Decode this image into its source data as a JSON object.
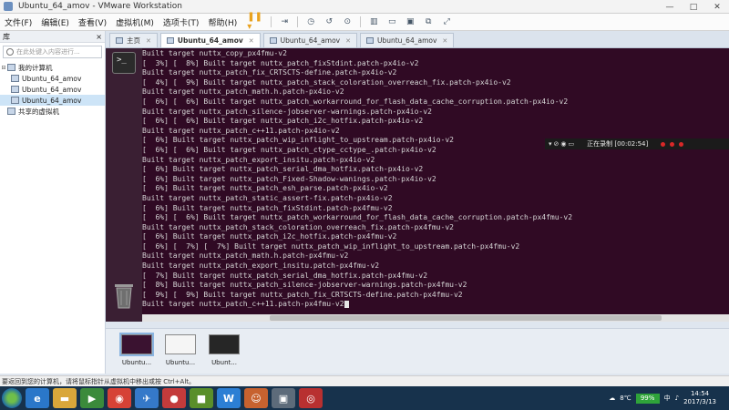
{
  "window": {
    "title": "Ubuntu_64_amov - VMware Workstation",
    "minimize": "—",
    "maximize": "□",
    "close": "✕"
  },
  "menu": {
    "items": [
      "文件(F)",
      "编辑(E)",
      "查看(V)",
      "虚拟机(M)",
      "选项卡(T)",
      "帮助(H)"
    ]
  },
  "library": {
    "header": "库",
    "close": "×",
    "search_placeholder": "在此处键入内容进行...",
    "tree": [
      {
        "label": "我的计算机",
        "level": 0,
        "selected": false
      },
      {
        "label": "Ubuntu_64_amov",
        "level": 1,
        "selected": false
      },
      {
        "label": "Ubuntu_64_amov",
        "level": 1,
        "selected": false
      },
      {
        "label": "Ubuntu_64_amov",
        "level": 1,
        "selected": true
      },
      {
        "label": "共享的虚拟机",
        "level": 0,
        "selected": false
      }
    ]
  },
  "tabs": [
    {
      "label": "主页",
      "active": false
    },
    {
      "label": "Ubuntu_64_amov",
      "active": true
    },
    {
      "label": "Ubuntu_64_amov",
      "active": false
    },
    {
      "label": "Ubuntu_64_amov",
      "active": false
    }
  ],
  "terminal": {
    "lines": [
      "Built target nuttx_copy_px4fmu-v2",
      "[  3%] [  8%] Built target nuttx_patch_fixStdint.patch-px4io-v2",
      "Built target nuttx_patch_fix_CRTSCTS-define.patch-px4io-v2",
      "[  4%] [  9%] Built target nuttx_patch_stack_coloration_overreach_fix.patch-px4io-v2",
      "Built target nuttx_patch_math.h.patch-px4io-v2",
      "[  6%] [  6%] Built target nuttx_patch_workarround_for_flash_data_cache_corruption.patch-px4io-v2",
      "Built target nuttx_patch_silence-jobserver-warnings.patch-px4io-v2",
      "[  6%] [  6%] Built target nuttx_patch_i2c_hotfix.patch-px4io-v2",
      "Built target nuttx_patch_c++11.patch-px4io-v2",
      "[  6%] Built target nuttx_patch_wip_inflight_to_upstream.patch-px4io-v2",
      "[  6%] [  6%] Built target nuttx_patch_ctype_cctype_.patch-px4io-v2",
      "Built target nuttx_patch_export_insitu.patch-px4io-v2",
      "[  6%] Built target nuttx_patch_serial_dma_hotfix.patch-px4io-v2",
      "[  6%] Built target nuttx_patch_Fixed-Shadow-wanings.patch-px4io-v2",
      "[  6%] Built target nuttx_patch_esh_parse.patch-px4io-v2",
      "Built target nuttx_patch_static_assert-fix.patch-px4io-v2",
      "[  6%] Built target nuttx_patch_fixStdint.patch-px4fmu-v2",
      "[  6%] [  6%] Built target nuttx_patch_workarround_for_flash_data_cache_corruption.patch-px4fmu-v2",
      "Built target nuttx_patch_stack_coloration_overreach_fix.patch-px4fmu-v2",
      "[  6%] Built target nuttx_patch_i2c_hotfix.patch-px4fmu-v2",
      "[  6%] [  7%] [  7%] Built target nuttx_patch_wip_inflight_to_upstream.patch-px4fmu-v2",
      "Built target nuttx_patch_math.h.patch-px4fmu-v2",
      "Built target nuttx_patch_export_insitu.patch-px4fmu-v2",
      "[  7%] Built target nuttx_patch_serial_dma_hotfix.patch-px4fmu-v2",
      "[  8%] Built target nuttx_patch_silence-jobserver-warnings.patch-px4fmu-v2",
      "[  9%] [  9%] Built target nuttx_patch_fix_CRTSCTS-define.patch-px4fmu-v2",
      "Built target nuttx_patch_c++11.patch-px4fmu-v2"
    ]
  },
  "recording": {
    "status": "正在录制 [00:02:54]"
  },
  "thumbnails": [
    {
      "label": "Ubuntu...",
      "selected": true
    },
    {
      "label": "Ubuntu...",
      "selected": false
    },
    {
      "label": "Ubunt...",
      "selected": false
    }
  ],
  "statusbar": {
    "text": "要返回到您的计算机，请将鼠标指针从虚拟机中移出或按 Ctrl+Alt。"
  },
  "taskbar": {
    "apps": [
      {
        "name": "ie-icon",
        "glyph": "e",
        "color": "#2a77c9"
      },
      {
        "name": "folder-icon",
        "glyph": "▬",
        "color": "#d9a73a"
      },
      {
        "name": "media-icon",
        "glyph": "▶",
        "color": "#3b8a3b"
      },
      {
        "name": "chrome-icon",
        "glyph": "◉",
        "color": "#d64236"
      },
      {
        "name": "feather-icon",
        "glyph": "✈",
        "color": "#3579c9"
      },
      {
        "name": "app-red-icon",
        "glyph": "●",
        "color": "#c43b3b"
      },
      {
        "name": "app-green-icon",
        "glyph": "■",
        "color": "#5a8f2a"
      },
      {
        "name": "wps-icon",
        "glyph": "W",
        "color": "#2c7fd4"
      },
      {
        "name": "app-face-icon",
        "glyph": "☺",
        "color": "#c7622f"
      },
      {
        "name": "vmware-icon",
        "glyph": "▣",
        "color": "#5d6b7a"
      },
      {
        "name": "recorder-icon",
        "glyph": "◎",
        "color": "#b83030"
      }
    ],
    "language": "中",
    "battery": "99%",
    "temp": "8℃",
    "time": "14:54",
    "date": "2017/3/13"
  },
  "colors": {
    "terminal_bg": "#300a24",
    "launcher_bg": "#3a1f33",
    "taskbar_bg": "#17324c"
  }
}
